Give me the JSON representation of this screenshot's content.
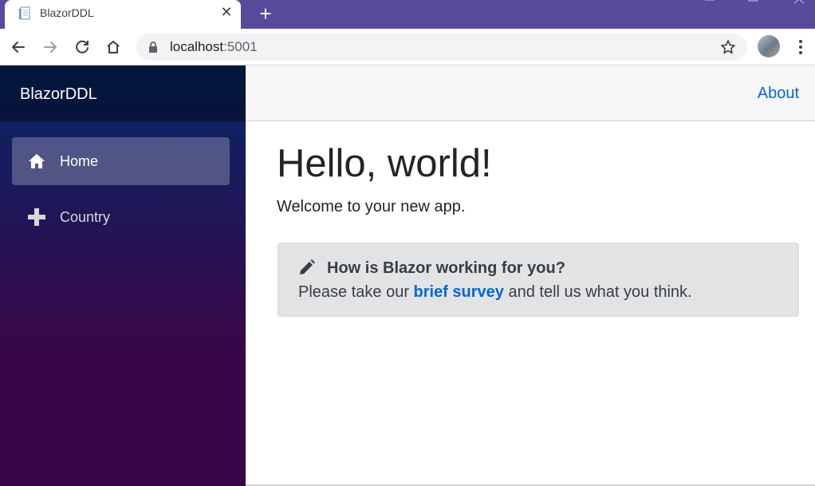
{
  "browser": {
    "tab_title": "BlazorDDL",
    "tab_favicon": "page-icon",
    "url_host": "localhost",
    "url_port": ":5001"
  },
  "sidebar": {
    "brand": "BlazorDDL",
    "items": [
      {
        "label": "Home",
        "icon": "home-icon",
        "active": true
      },
      {
        "label": "Country",
        "icon": "plus-icon",
        "active": false
      }
    ]
  },
  "topbar": {
    "about_label": "About"
  },
  "main": {
    "heading": "Hello, world!",
    "welcome": "Welcome to your new app.",
    "survey": {
      "title": "How is Blazor working for you?",
      "text_before": "Please take our ",
      "link_text": "brief survey",
      "text_after": " and tell us what you think."
    }
  },
  "colors": {
    "accent_link": "#0366d6",
    "tabstrip": "#5a4a9c",
    "sidebar_top": "#052767",
    "sidebar_bottom": "#3a0647"
  }
}
